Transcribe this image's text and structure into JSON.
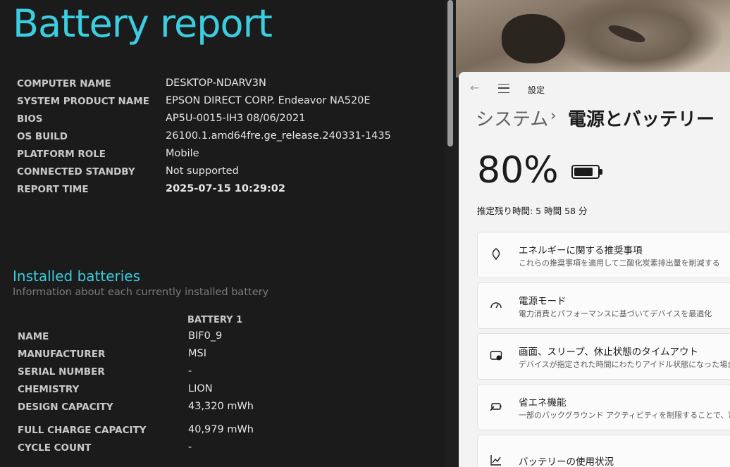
{
  "report": {
    "title": "Battery report",
    "system_info": [
      {
        "label": "COMPUTER NAME",
        "value": "DESKTOP-NDARV3N"
      },
      {
        "label": "SYSTEM PRODUCT NAME",
        "value": "EPSON DIRECT CORP. Endeavor NA520E"
      },
      {
        "label": "BIOS",
        "value": "AP5U-0015-IH3 08/06/2021"
      },
      {
        "label": "OS BUILD",
        "value": "26100.1.amd64fre.ge_release.240331-1435"
      },
      {
        "label": "PLATFORM ROLE",
        "value": "Mobile"
      },
      {
        "label": "CONNECTED STANDBY",
        "value": "Not supported"
      },
      {
        "label": "REPORT TIME",
        "value": "2025-07-15  10:29:02"
      }
    ],
    "installed": {
      "title": "Installed batteries",
      "subtitle": "Information about each currently installed battery",
      "column_header": "BATTERY 1",
      "rows": [
        {
          "label": "NAME",
          "value": "BIF0_9"
        },
        {
          "label": "MANUFACTURER",
          "value": "MSI"
        },
        {
          "label": "SERIAL NUMBER",
          "value": "-"
        },
        {
          "label": "CHEMISTRY",
          "value": "LION"
        },
        {
          "label": "DESIGN CAPACITY",
          "value": "43,320 mWh"
        },
        {
          "label": "FULL CHARGE CAPACITY",
          "value": "40,979 mWh"
        },
        {
          "label": "CYCLE COUNT",
          "value": "-"
        }
      ]
    }
  },
  "settings": {
    "app_title": "設定",
    "breadcrumb_parent": "システム",
    "breadcrumb_separator": "›",
    "breadcrumb_current": "電源とバッテリー",
    "battery_percent": "80%",
    "battery_level": 0.8,
    "remaining_time": "推定残り時間: 5 時間 58 分",
    "cards": [
      {
        "icon": "leaf-icon",
        "title": "エネルギーに関する推奨事項",
        "subtitle": "これらの推奨事項を適用して二酸化炭素排出量を削減する"
      },
      {
        "icon": "gauge-icon",
        "title": "電源モード",
        "subtitle": "電力消費とパフォーマンスに基づいてデバイスを最適化"
      },
      {
        "icon": "screen-sleep-icon",
        "title": "画面、スリープ、休止状態のタイムアウト",
        "subtitle": "デバイスが指定された時間にわたりアイドル状態になった場合の動"
      },
      {
        "icon": "battery-saver-icon",
        "title": "省エネ機能",
        "subtitle": "一部のバックグラウンド アクティビティを制限することで、電力消"
      },
      {
        "icon": "chart-icon",
        "title": "バッテリーの使用状況",
        "subtitle": ""
      }
    ]
  },
  "colors": {
    "accent": "#3bcde0",
    "report_bg": "#1b1b1b",
    "settings_bg": "#f3f3f3"
  }
}
